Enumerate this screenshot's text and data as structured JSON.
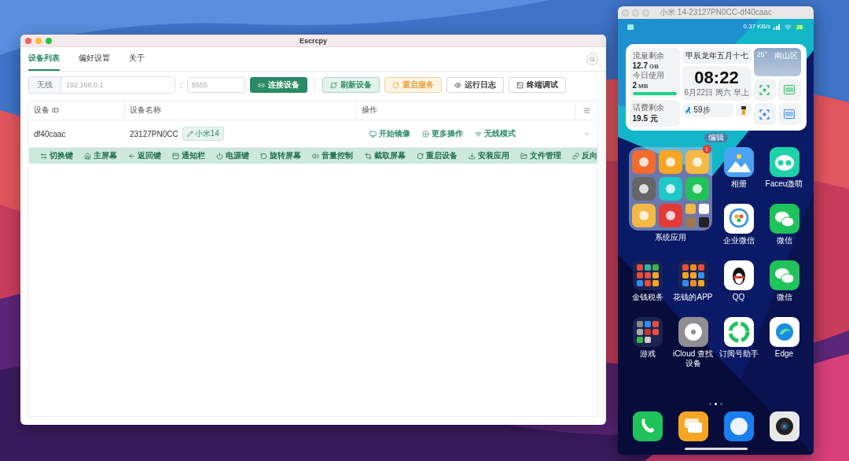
{
  "escrcpy": {
    "title": "Escrcpy",
    "tabs": [
      {
        "label": "设备列表",
        "selected": true
      },
      {
        "label": "偏好设置",
        "selected": false
      },
      {
        "label": "关于",
        "selected": false
      }
    ],
    "connect": {
      "prefix": "无线",
      "host": {
        "placeholder": "192.168.0.1"
      },
      "separator": ":",
      "port": {
        "placeholder": "5555"
      }
    },
    "buttons": [
      {
        "label": "连接设备",
        "kind": "primary"
      },
      {
        "label": "刷新设备",
        "kind": "success"
      },
      {
        "label": "重启服务",
        "kind": "warning"
      },
      {
        "label": "运行日志",
        "kind": "plain"
      },
      {
        "label": "终端调试",
        "kind": "plain"
      }
    ],
    "table": {
      "columns": [
        "设备 ID",
        "设备名称",
        "操作"
      ],
      "rows": [
        {
          "id": "df40caac",
          "name": "23127PN0CC",
          "tag": "小米14",
          "actions": [
            "开始镜像",
            "更多操作",
            "无线模式"
          ],
          "expanded": true,
          "controls": [
            "切换键",
            "主屏幕",
            "返回键",
            "通知栏",
            "电源键",
            "旋转屏幕",
            "音量控制",
            "截取屏幕",
            "重启设备",
            "安装应用",
            "文件管理",
            "反向"
          ]
        }
      ]
    }
  },
  "mirror": {
    "title": "小米 14-23127PN0CC-df40caac",
    "status": {
      "speed": "0.37 KB/s",
      "battery": "28"
    },
    "widget": {
      "data_label": "流量剩余",
      "data_value": "12.7",
      "data_unit": "GB",
      "today_label": "今日使用",
      "today_value": "2",
      "today_unit": "MB",
      "level": 1,
      "balance_label": "话费剩余",
      "balance_value": "19.5 元",
      "lunar": "甲辰龙年五月十七",
      "time": "08:22",
      "date": "6月22日 周六 早上",
      "steps": "59步",
      "temperature": "25°",
      "location": "南山区"
    },
    "edit_label": "编辑",
    "apps": [
      {
        "label": "系统应用",
        "kind": "big_folder",
        "badge": "1"
      },
      {
        "label": "相册",
        "kind": "app"
      },
      {
        "label": "Faceu激萌",
        "kind": "app"
      },
      {
        "label": "企业微信",
        "kind": "app"
      },
      {
        "label": "微信",
        "kind": "app"
      },
      {
        "label": "金钱税务",
        "kind": "folder"
      },
      {
        "label": "花钱的APP",
        "kind": "folder"
      },
      {
        "label": "QQ",
        "kind": "app"
      },
      {
        "label": "微信",
        "kind": "app"
      },
      {
        "label": "游戏",
        "kind": "folder"
      },
      {
        "label": "iCloud 查找设备",
        "kind": "app"
      },
      {
        "label": "订阅号助手",
        "kind": "app"
      },
      {
        "label": "Edge",
        "kind": "app"
      }
    ],
    "page_dots": [
      {
        "selected": false
      },
      {
        "selected": true
      },
      {
        "selected": false
      }
    ]
  }
}
